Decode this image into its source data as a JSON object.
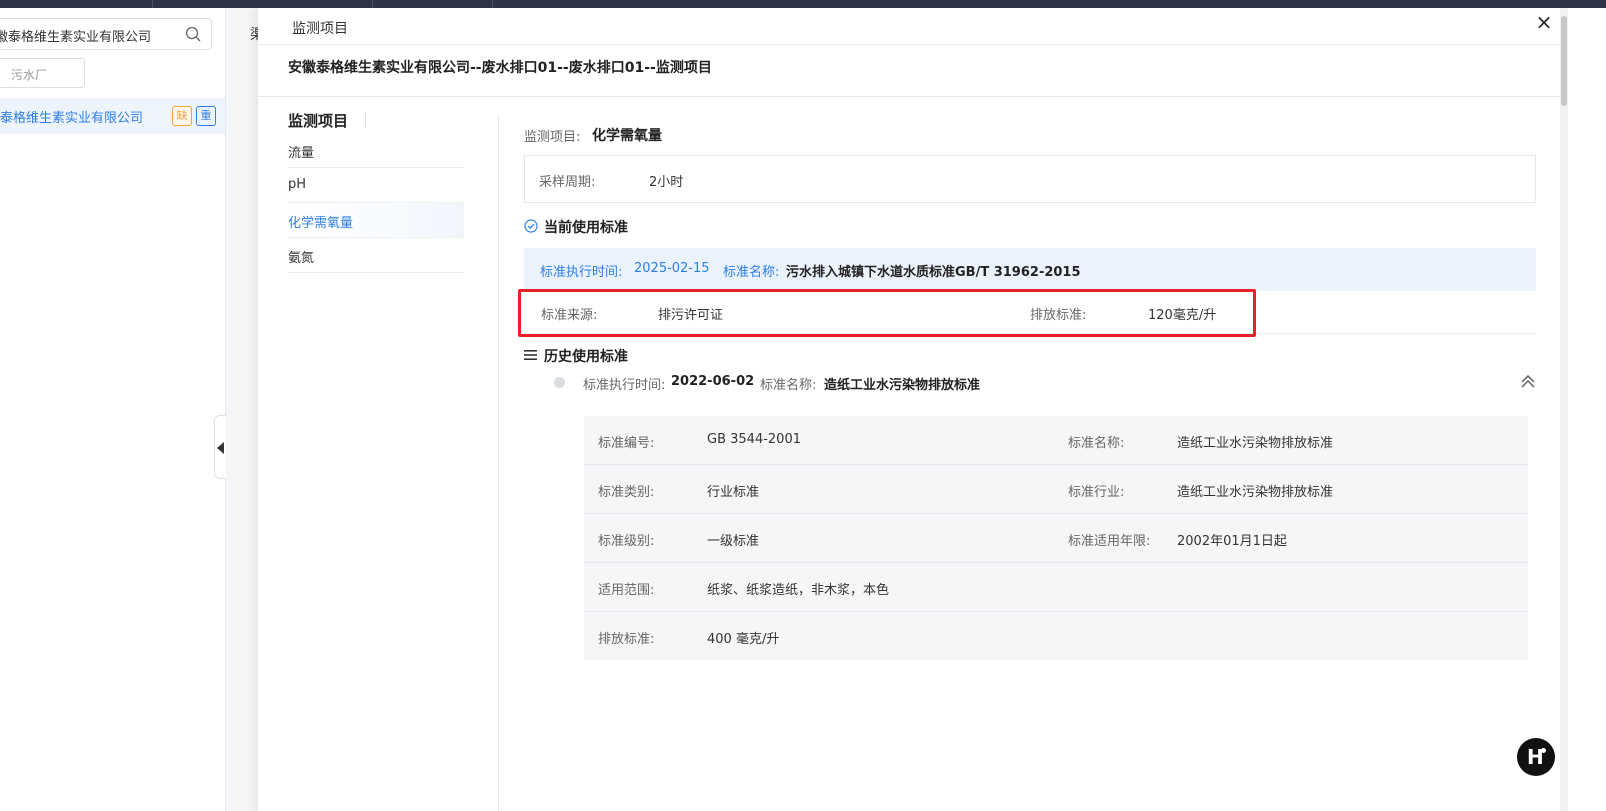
{
  "sidebar": {
    "search_value": "徽泰格维生素实业有限公司",
    "filter_chip": "污水厂",
    "company_name": "泰格维生素实业有限公司",
    "tag_missing": "缺",
    "tag_key": "重"
  },
  "background_char": "渠",
  "drawer": {
    "title": "监测项目",
    "close_label": "×",
    "full_title": "安徽泰格维生素实业有限公司--废水排口01--废水排口01--监测项目"
  },
  "nav": {
    "title": "监测项目",
    "items": [
      {
        "label": "流量"
      },
      {
        "label": "pH"
      },
      {
        "label": "化学需氧量"
      },
      {
        "label": "氨氮"
      }
    ],
    "active_index": 2
  },
  "detail": {
    "item_label": "监测项目:",
    "item_value": "化学需氧量",
    "sampling_label": "采样周期:",
    "sampling_value": "2小时",
    "current_title": "当前使用标准",
    "current": {
      "exec_time_label": "标准执行时间:",
      "exec_time_value": "2025-02-15",
      "name_label": "标准名称:",
      "name_value": "污水排入城镇下水道水质标准GB/T 31962-2015",
      "source_label": "标准来源:",
      "source_value": "排污许可证",
      "limit_label": "排放标准:",
      "limit_value": "120毫克/升"
    },
    "history_title": "历史使用标准",
    "history": {
      "exec_time_label": "标准执行时间:",
      "exec_time_value": "2022-06-02",
      "name_label": "标准名称:",
      "name_value": "造纸工业水污染物排放标准",
      "rows": [
        {
          "k1": "标准编号:",
          "v1": "GB 3544-2001",
          "k2": "标准名称:",
          "v2": "造纸工业水污染物排放标准"
        },
        {
          "k1": "标准类别:",
          "v1": "行业标准",
          "k2": "标准行业:",
          "v2": "造纸工业水污染物排放标准"
        },
        {
          "k1": "标准级别:",
          "v1": "一级标准",
          "k2": "标准适用年限:",
          "v2": "2002年01月1日起"
        },
        {
          "k1": "适用范围:",
          "v1": "纸浆、纸浆造纸，非木浆，本色",
          "k2": "",
          "v2": ""
        },
        {
          "k1": "排放标准:",
          "v1": "400 毫克/升",
          "k2": "",
          "v2": ""
        }
      ]
    }
  },
  "colors": {
    "accent": "#2d7ee6",
    "highlight_border": "#e8212a",
    "current_bar_bg": "#eaf3fd"
  },
  "icons": [
    "search-icon",
    "check-circle-icon",
    "list-icon",
    "chevron-up-icon",
    "close-icon",
    "collapse-arrow-icon",
    "assistant-logo-icon"
  ]
}
